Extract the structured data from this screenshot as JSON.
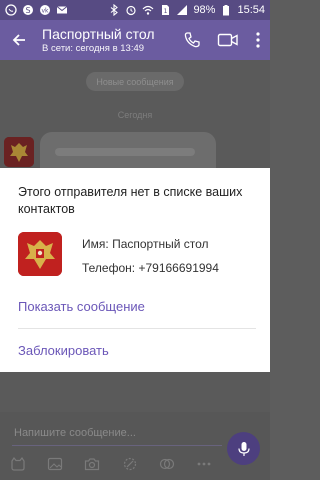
{
  "status_bar": {
    "battery": "98%",
    "time": "15:54",
    "icons": [
      "viber-icon",
      "skype-icon",
      "vk-icon",
      "mail-icon",
      "bluetooth-icon",
      "alarm-icon",
      "wifi-icon",
      "sim-icon",
      "signal-icon",
      "battery-icon"
    ]
  },
  "header": {
    "title": "Паспортный стол",
    "subtitle": "В сети: сегодня в 13:49",
    "icons": [
      "back-arrow-icon",
      "phone-icon",
      "video-icon",
      "more-vertical-icon"
    ]
  },
  "chat": {
    "new_messages": "Новые сообщения",
    "date_label": "Сегодня"
  },
  "dialog": {
    "title": "Этого отправителя нет в списке ваших контактов",
    "name_label": "Имя:",
    "name_value": "Паспортный стол",
    "phone_label": "Телефон:",
    "phone_value": "+79166691994",
    "show_message": "Показать сообщение",
    "block": "Заблокировать"
  },
  "composer": {
    "placeholder": "Напишите сообщение...",
    "tools": [
      "sticker-icon",
      "gallery-icon",
      "camera-icon",
      "doodle-icon",
      "gif-icon",
      "more-icon"
    ]
  },
  "colors": {
    "header": "#6b5ca0",
    "status_bar": "#574b83",
    "accent": "#6b57b8"
  }
}
